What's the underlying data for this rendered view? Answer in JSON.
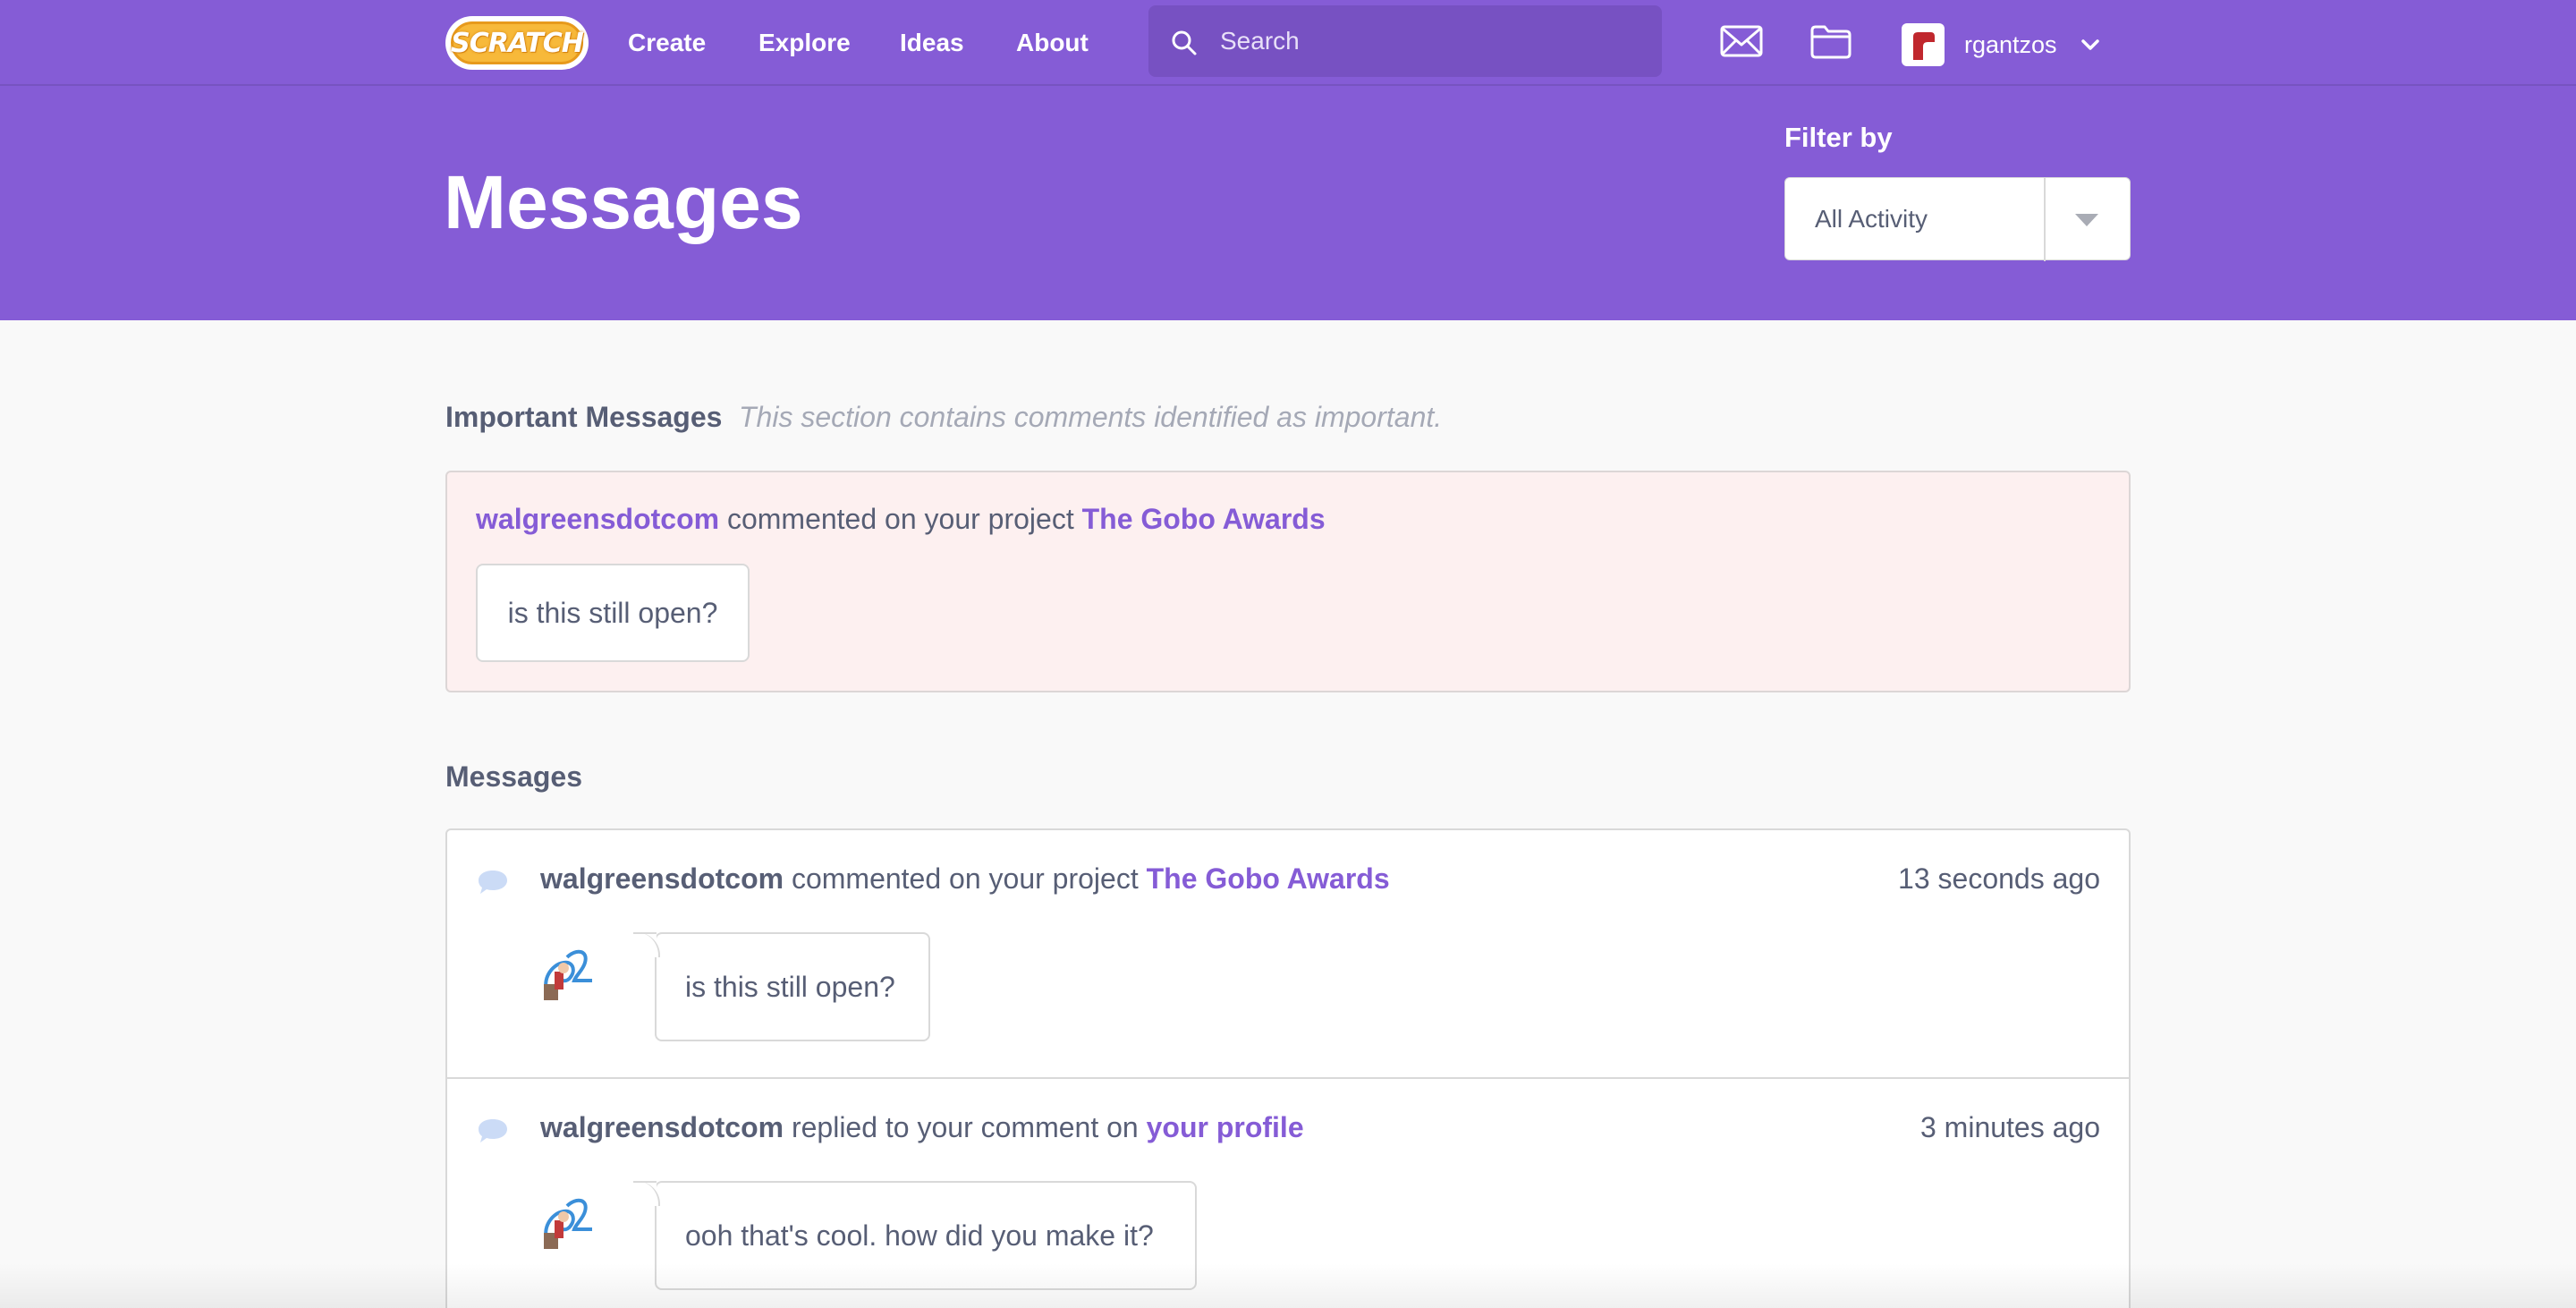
{
  "nav": {
    "logo_text": "SCRATCH",
    "links": [
      "Create",
      "Explore",
      "Ideas",
      "About"
    ],
    "search_placeholder": "Search",
    "username": "rgantzos"
  },
  "hero": {
    "title": "Messages",
    "filter_label": "Filter by",
    "filter_value": "All Activity"
  },
  "important": {
    "title": "Important Messages",
    "note": "This section contains comments identified as important.",
    "message": {
      "user": "walgreensdotcom",
      "action": "commented on your project",
      "target": "The Gobo Awards",
      "comment": "is this still open?"
    }
  },
  "messages": {
    "title": "Messages",
    "items": [
      {
        "user": "walgreensdotcom",
        "action": "commented on your project",
        "target": "The Gobo Awards",
        "time": "13 seconds ago",
        "comment": "is this still open?"
      },
      {
        "user": "walgreensdotcom",
        "action": "replied to your comment on",
        "target": "your profile",
        "time": "3 minutes ago",
        "comment": "ooh that's cool. how did you make it?"
      }
    ]
  },
  "colors": {
    "brand": "#855cd6",
    "important_bg": "#fdf0f0",
    "text": "#575e75"
  }
}
